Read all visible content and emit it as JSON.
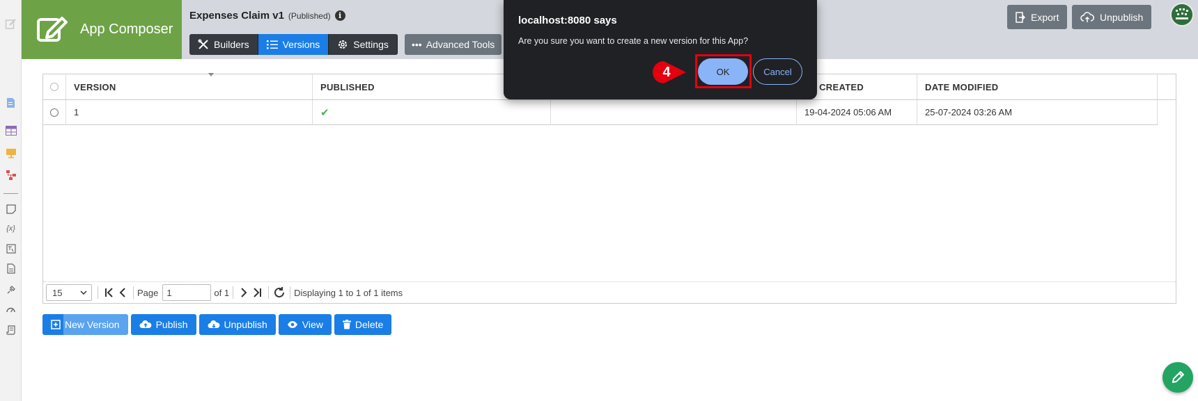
{
  "brand": {
    "title": "App Composer"
  },
  "app": {
    "name": "Expenses Claim v1",
    "status": "(Published)",
    "info_glyph": "i"
  },
  "tabs": [
    {
      "label": "Builders",
      "icon": "builders-icon"
    },
    {
      "label": "Versions",
      "icon": "list-icon",
      "active": true
    },
    {
      "label": "Settings",
      "icon": "gear-icon"
    }
  ],
  "advanced_tools": {
    "label": "Advanced Tools",
    "glyph": "•••"
  },
  "header_buttons": {
    "export": "Export",
    "unpublish": "Unpublish"
  },
  "table": {
    "columns": [
      "VERSION",
      "PUBLISHED",
      "",
      "TE CREATED",
      "DATE MODIFIED"
    ],
    "rows": [
      {
        "version": "1",
        "published": "✔",
        "col3": "",
        "date_created": "19-04-2024 05:06 AM",
        "date_modified": "25-07-2024 03:26 AM"
      }
    ]
  },
  "pager": {
    "page_size": "15",
    "page_label": "Page",
    "page_value": "1",
    "of_label": "of 1",
    "summary": "Displaying 1 to 1 of 1 items"
  },
  "actions": {
    "new_version": "New Version",
    "publish": "Publish",
    "unpublish": "Unpublish",
    "view": "View",
    "delete": "Delete"
  },
  "dialog": {
    "title": "localhost:8080 says",
    "message": "Are you sure you want to create a new version for this App?",
    "ok": "OK",
    "cancel": "Cancel"
  },
  "step_marker": "4",
  "colors": {
    "brand_green": "#6da346",
    "primary_blue": "#1a7ee6",
    "dark_tab": "#343a40",
    "gray_button": "#6c757d",
    "dialog_bg": "#202124",
    "dialog_accent": "#8ab4f8",
    "highlight_red": "#e3000f",
    "fab_green": "#23a463"
  }
}
